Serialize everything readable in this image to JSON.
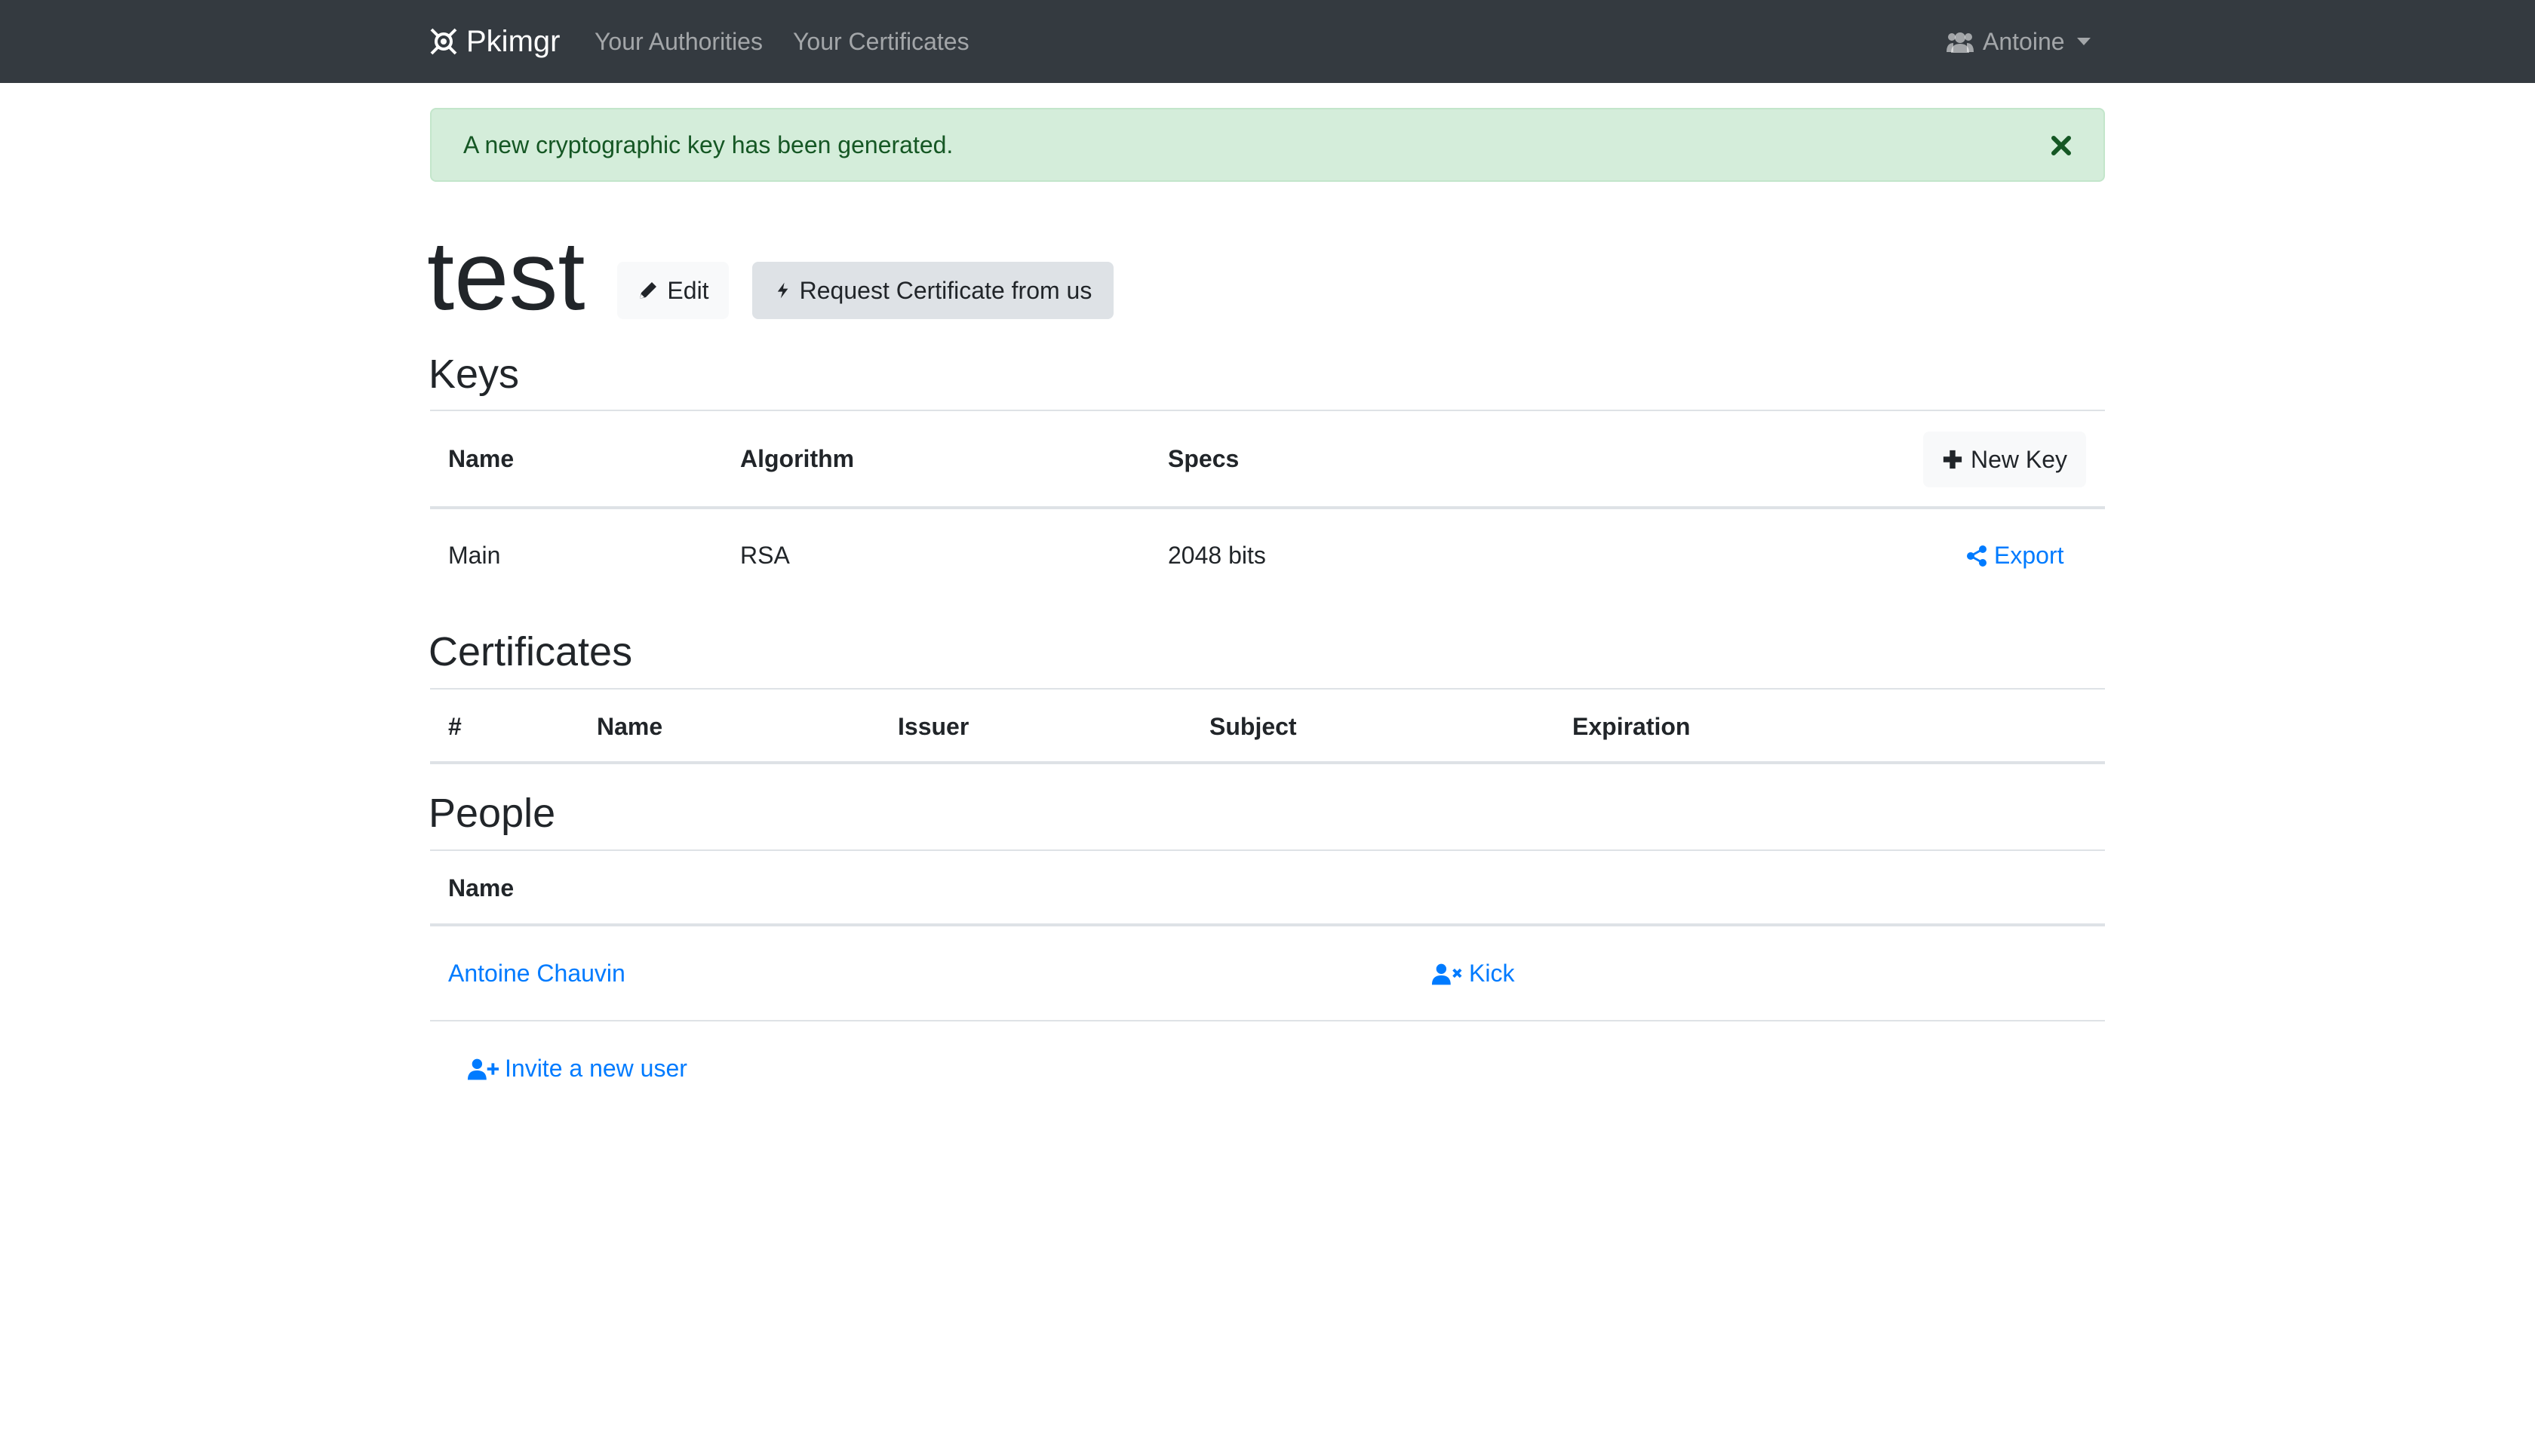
{
  "navbar": {
    "brand": "Pkimgr",
    "links": [
      "Your Authorities",
      "Your Certificates"
    ],
    "user": "Antoine"
  },
  "alert": {
    "message": "A new cryptographic key has been generated."
  },
  "authority": {
    "title": "test",
    "edit_label": "Edit",
    "request_label": "Request Certificate from us"
  },
  "keys": {
    "heading": "Keys",
    "columns": [
      "Name",
      "Algorithm",
      "Specs"
    ],
    "new_key_label": "New Key",
    "rows": [
      {
        "name": "Main",
        "algorithm": "RSA",
        "specs": "2048 bits",
        "action": "Export"
      }
    ]
  },
  "certificates": {
    "heading": "Certificates",
    "columns": [
      "#",
      "Name",
      "Issuer",
      "Subject",
      "Expiration"
    ]
  },
  "people": {
    "heading": "People",
    "columns": [
      "Name"
    ],
    "rows": [
      {
        "name": "Antoine Chauvin",
        "action": "Kick"
      }
    ],
    "invite_label": "Invite a new user"
  },
  "colors": {
    "navbar": "#343a40",
    "link": "#007bff",
    "alert_bg": "#d4edda",
    "alert_text": "#155724"
  }
}
